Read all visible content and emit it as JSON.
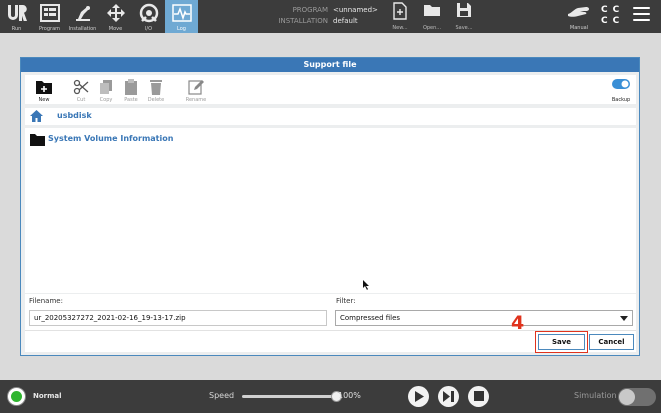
{
  "topbar": {
    "nav": [
      {
        "label": "Run",
        "icon": "ur-logo-icon"
      },
      {
        "label": "Program",
        "icon": "program-icon"
      },
      {
        "label": "Installation",
        "icon": "installation-icon"
      },
      {
        "label": "Move",
        "icon": "move-icon"
      },
      {
        "label": "I/O",
        "icon": "io-icon"
      },
      {
        "label": "Log",
        "icon": "log-icon",
        "active": true
      }
    ],
    "program_label": "PROGRAM",
    "program_value": "<unnamed>",
    "installation_label": "INSTALLATION",
    "installation_value": "default",
    "new_label": "New...",
    "open_label": "Open...",
    "save_label": "Save...",
    "manual_label": "Manual",
    "cccc": [
      "C",
      "C",
      "C",
      "C"
    ]
  },
  "dialog": {
    "title": "Support file",
    "toolbar": {
      "new": "New",
      "cut": "Cut",
      "copy": "Copy",
      "paste": "Paste",
      "delete": "Delete",
      "rename": "Rename",
      "backup": "Backup"
    },
    "path": "usbdisk",
    "files": [
      {
        "name": "System Volume Information",
        "type": "folder"
      }
    ],
    "filename_label": "Filename:",
    "filename_value": "ur_20205327272_2021-02-16_19-13-17.zip",
    "filter_label": "Filter:",
    "filter_value": "Compressed files",
    "save_button": "Save",
    "cancel_button": "Cancel"
  },
  "annotation": {
    "step": "4",
    "color": "#e0331d"
  },
  "statusbar": {
    "mode": "Normal",
    "speed_label": "Speed",
    "speed_value": "100%",
    "speed_fraction": 1.0,
    "simulation_label": "Simulation"
  },
  "colors": {
    "accent": "#3a77b6",
    "active_tab": "#6fa9d3",
    "bar_bg": "#3c3c3c",
    "status_led": "#2fb52f"
  }
}
